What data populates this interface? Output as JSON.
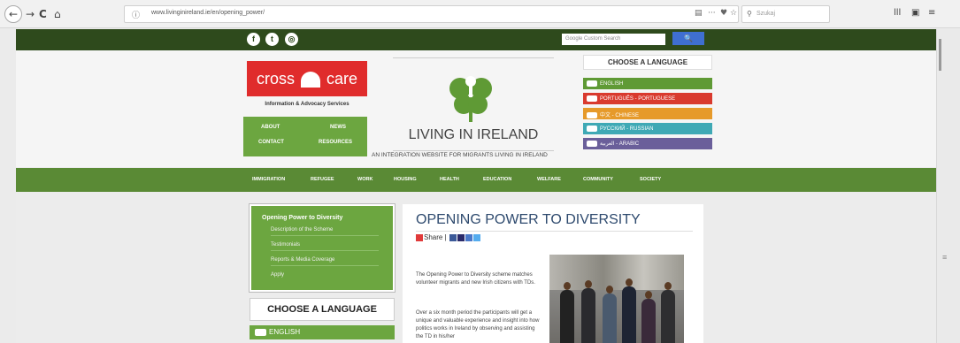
{
  "browser": {
    "back": "←",
    "forward": "→",
    "reload": "C",
    "home": "⌂",
    "url": "www.livinginireland.ie/en/opening_power/",
    "search_placeholder": "Szukaj",
    "reader_icon": "▤",
    "more_icon": "···",
    "pocket_icon": "♥",
    "bookmark_icon": "☆",
    "library_icon": "lll",
    "sidebar_icon": "▣",
    "menu_icon": "≡"
  },
  "site": {
    "social": [
      "f",
      "t",
      "◎"
    ],
    "search_placeholder": "Google Custom Search",
    "search_btn": "🔍",
    "logo": {
      "left": "cross",
      "right": "care",
      "subtitle": "Information & Advocacy Services"
    },
    "about_links": [
      "ABOUT",
      "NEWS",
      "CONTACT",
      "RESOURCES"
    ],
    "main_title": "LIVING IN IRELAND",
    "tagline": "AN INTEGRATION WEBSITE FOR MIGRANTS LIVING IN IRELAND",
    "language_head": "CHOOSE A LANGUAGE",
    "languages": [
      {
        "label": "ENGLISH",
        "color": "#5f9a35"
      },
      {
        "label": "PORTUGUÊS - PORTUGUESE",
        "color": "#d93a2e"
      },
      {
        "label": "中文 - CHINESE",
        "color": "#e69a2a"
      },
      {
        "label": "РУССКИЙ - RUSSIAN",
        "color": "#3fa9b5"
      },
      {
        "label": "العربية - ARABIC",
        "color": "#6a5f9a"
      }
    ],
    "nav": [
      "IMMIGRATION",
      "REFUGEE",
      "WORK",
      "HOUSING",
      "HEALTH",
      "EDUCATION",
      "WELFARE",
      "COMMUNITY",
      "SOCIETY"
    ],
    "sidemenu": {
      "head": "Opening Power to Diversity",
      "items": [
        "Description of the Scheme",
        "Testimonials",
        "Reports & Media Coverage",
        "Apply"
      ]
    },
    "language_head2": "CHOOSE A LANGUAGE",
    "english2": "ENGLISH",
    "content": {
      "title": "OPENING POWER TO DIVERSITY",
      "share": "Share |",
      "para1": "The Opening Power to Diversity scheme matches volunteer migrants and new Irish citizens with TDs.",
      "para2": "Over a six month period the participants will get a unique and valuable experience and insight into how politics works in Ireland by observing and assisting the TD in his/her"
    }
  }
}
